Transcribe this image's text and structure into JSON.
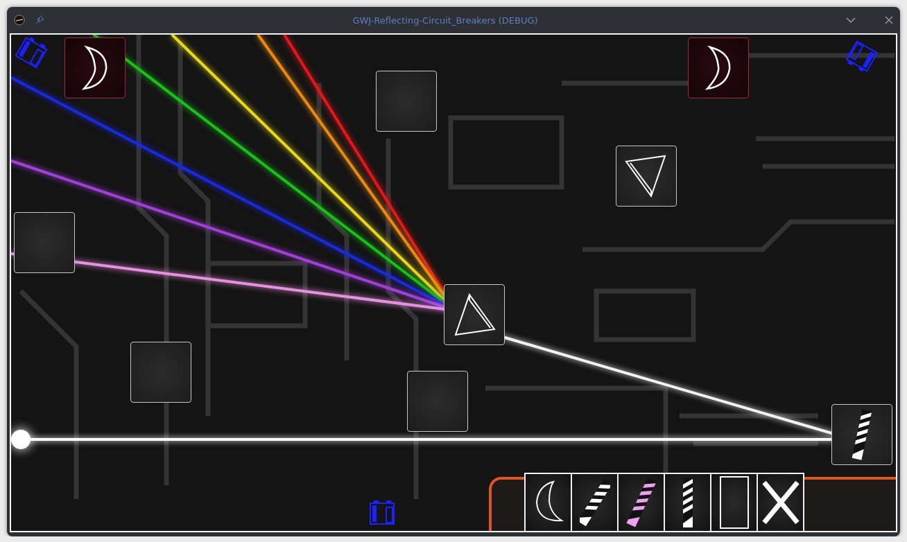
{
  "window": {
    "title": "GWJ-Reflecting-Circuit_Breakers (DEBUG)"
  },
  "board": {
    "tiles": [
      {
        "kind": "moon"
      },
      {
        "kind": "moon"
      },
      {
        "kind": "empty"
      },
      {
        "kind": "prism"
      },
      {
        "kind": "empty"
      },
      {
        "kind": "prism"
      },
      {
        "kind": "empty"
      },
      {
        "kind": "empty"
      },
      {
        "kind": "mirror"
      }
    ]
  },
  "toolbar": {
    "items": [
      {
        "kind": "moon"
      },
      {
        "kind": "mirror"
      },
      {
        "kind": "filter-mirror"
      },
      {
        "kind": "upright-mirror"
      },
      {
        "kind": "block"
      },
      {
        "kind": "delete"
      }
    ]
  }
}
